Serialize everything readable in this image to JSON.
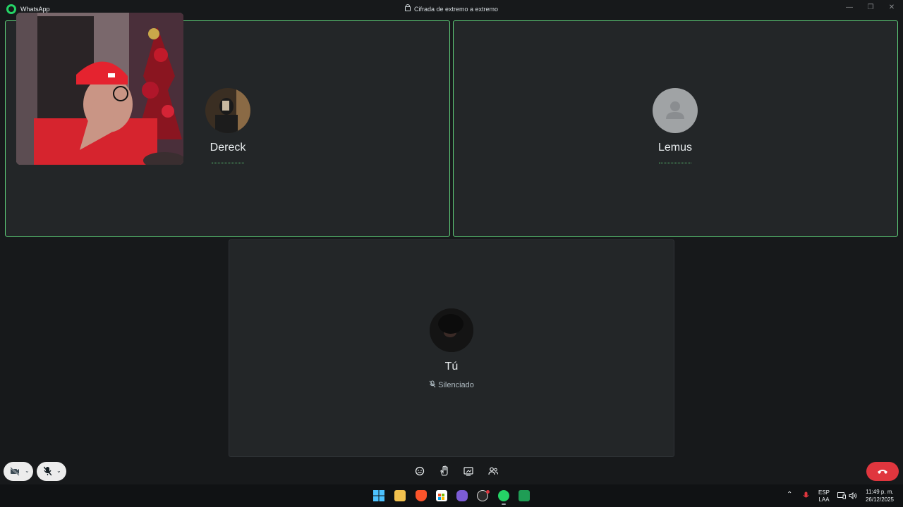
{
  "titlebar": {
    "app_name": "WhatsApp",
    "encryption_text": "Cifrada de extremo a extremo"
  },
  "participants": [
    {
      "name": "Dereck",
      "status": "calling",
      "avatar": "photo"
    },
    {
      "name": "Lemus",
      "status": "calling",
      "avatar": "default-person-icon"
    }
  ],
  "self": {
    "name": "Tú",
    "status_label": "Silenciado"
  },
  "controls": {
    "left": [
      "video-off-icon",
      "mic-off-icon"
    ],
    "center": [
      "emoji-icon",
      "raise-hand-icon",
      "screen-share-icon",
      "participants-icon"
    ],
    "end_call": "phone-hangup-icon",
    "end_call_color": "#e0363e"
  },
  "accent_color": "#5fd07a",
  "taskbar": {
    "apps": [
      "windows-start-icon",
      "file-explorer-icon",
      "brave-icon",
      "store-icon",
      "game-icon",
      "obs-icon",
      "whatsapp-icon",
      "app-icon"
    ],
    "lang_top": "ESP",
    "lang_bottom": "LAA",
    "time": "11:49 p. m.",
    "date": "26/12/2025"
  }
}
